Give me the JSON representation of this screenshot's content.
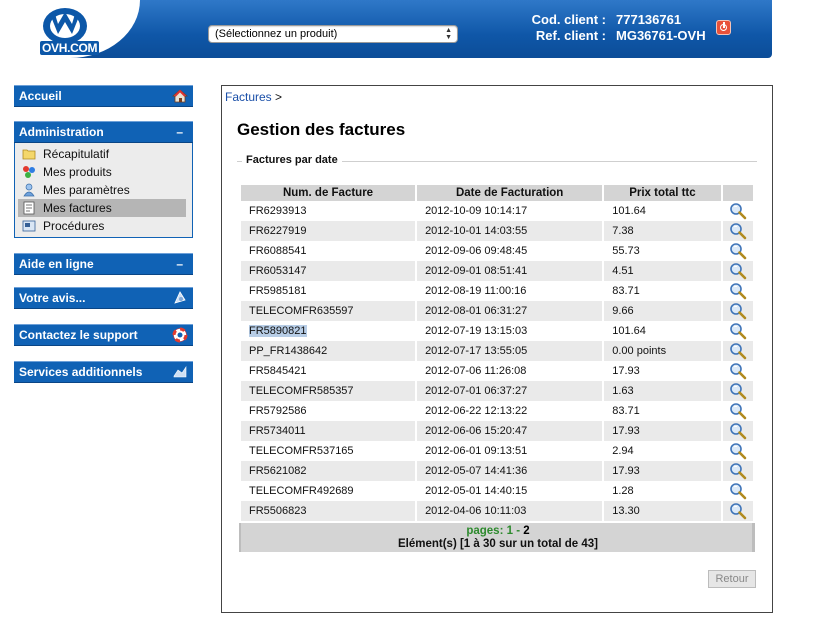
{
  "header": {
    "logo_text": "OVH.COM",
    "product_select": "(Sélectionnez un produit)",
    "client_code_label": "Cod. client :",
    "client_code": "777136761",
    "client_ref_label": "Ref. client :",
    "client_ref": "MG36761-OVH"
  },
  "menu": {
    "accueil": "Accueil",
    "administration": "Administration",
    "admin_items": [
      {
        "label": "Récapitulatif",
        "icon": "folder-icon"
      },
      {
        "label": "Mes produits",
        "icon": "products-icon"
      },
      {
        "label": "Mes paramètres",
        "icon": "user-icon"
      },
      {
        "label": "Mes factures",
        "icon": "invoice-icon",
        "active": true
      },
      {
        "label": "Procédures",
        "icon": "procedures-icon"
      }
    ],
    "aide": "Aide en ligne",
    "avis": "Votre avis...",
    "support": "Contactez le support",
    "services": "Services additionnels"
  },
  "content": {
    "breadcrumb_link": "Factures",
    "breadcrumb_sep": ">",
    "title": "Gestion des factures",
    "section": "Factures par date",
    "columns": [
      "Num. de Facture",
      "Date de Facturation",
      "Prix total ttc"
    ],
    "rows": [
      {
        "num": "FR6293913",
        "date": "2012-10-09 10:14:17",
        "price": "101.64"
      },
      {
        "num": "FR6227919",
        "date": "2012-10-01 14:03:55",
        "price": "7.38"
      },
      {
        "num": "FR6088541",
        "date": "2012-09-06 09:48:45",
        "price": "55.73"
      },
      {
        "num": "FR6053147",
        "date": "2012-09-01 08:51:41",
        "price": "4.51"
      },
      {
        "num": "FR5985181",
        "date": "2012-08-19 11:00:16",
        "price": "83.71"
      },
      {
        "num": "TELECOMFR635597",
        "date": "2012-08-01 06:31:27",
        "price": "9.66"
      },
      {
        "num": "FR5890821",
        "date": "2012-07-19 13:15:03",
        "price": "101.64"
      },
      {
        "num": "PP_FR1438642",
        "date": "2012-07-17 13:55:05",
        "price": "0.00 points"
      },
      {
        "num": "FR5845421",
        "date": "2012-07-06 11:26:08",
        "price": "17.93"
      },
      {
        "num": "TELECOMFR585357",
        "date": "2012-07-01 06:37:27",
        "price": "1.63"
      },
      {
        "num": "FR5792586",
        "date": "2012-06-22 12:13:22",
        "price": "83.71"
      },
      {
        "num": "FR5734011",
        "date": "2012-06-06 15:20:47",
        "price": "17.93"
      },
      {
        "num": "TELECOMFR537165",
        "date": "2012-06-01 09:13:51",
        "price": "2.94"
      },
      {
        "num": "FR5621082",
        "date": "2012-05-07 14:41:36",
        "price": "17.93"
      },
      {
        "num": "TELECOMFR492689",
        "date": "2012-05-01 14:40:15",
        "price": "1.28"
      },
      {
        "num": "FR5506823",
        "date": "2012-04-06 10:11:03",
        "price": "13.30"
      }
    ],
    "highlighted_row": 6,
    "pager_label": "pages:",
    "pager_current": "1",
    "pager_sep": "-",
    "pager_other": "2",
    "elements": "Elément(s) [1 à 30 sur un total de 43]",
    "retour": "Retour"
  },
  "colors": {
    "header_blue": "#0f57a8",
    "menu_blue": "#1062b5",
    "link_blue": "#1a4fa8",
    "pager_green": "#2d8a2d"
  }
}
